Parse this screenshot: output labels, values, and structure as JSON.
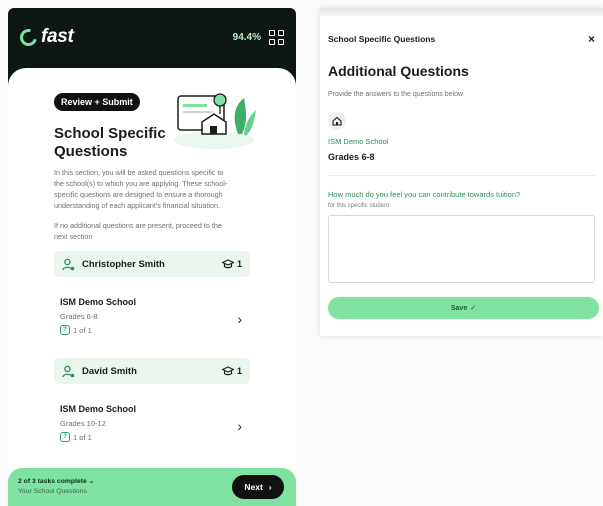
{
  "phone": {
    "brand": "fast",
    "progress": "94.4%",
    "badge": "Review + Submit",
    "title": "School Specific Questions",
    "description": "In this section, you will be asked questions specific to the school(s) to which you are applying. These school-specific questions are designed to ensure a thorough understanding of each applicant's financial situation.",
    "note": "If no additional questions are present, proceed to the next section",
    "students": [
      {
        "name": "Christopher Smith",
        "count": "1",
        "school": "ISM Demo School",
        "grades": "Grades 6-8",
        "questions": "1 of 1"
      },
      {
        "name": "David Smith",
        "count": "1",
        "school": "ISM Demo School",
        "grades": "Grades 10-12",
        "questions": "1 of 1"
      }
    ],
    "footer": {
      "tasks": "2 of 3 tasks complete",
      "caret": "⌄",
      "section": "Your School Questions",
      "next_label": "Next"
    }
  },
  "panel": {
    "header": "School Specific Questions",
    "close": "×",
    "title": "Additional Questions",
    "subtitle": "Provide the answers to the questions below",
    "school": "ISM Demo School",
    "grades": "Grades 6-8",
    "question": "How much do you feel you can contribute towards tuition?",
    "question_sub": "for this specific student",
    "answer": "",
    "save_label": "Save",
    "save_check": "✓"
  },
  "colors": {
    "accent_green": "#7fe2a0",
    "dark": "#0f1714",
    "link_green": "#2a8f58"
  }
}
